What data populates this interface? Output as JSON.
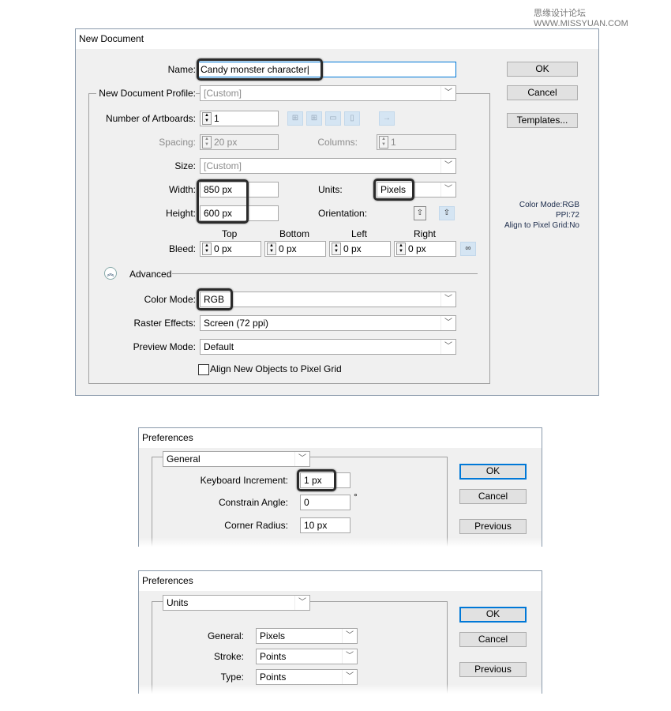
{
  "watermark": "思缘设计论坛 WWW.MISSYUAN.COM",
  "new_document": {
    "title": "New Document",
    "name_label": "Name:",
    "name_value": "Candy monster character",
    "profile_label": "New Document Profile:",
    "profile_value": "[Custom]",
    "artboards_label": "Number of Artboards:",
    "artboards_value": "1",
    "spacing_label": "Spacing:",
    "spacing_value": "20 px",
    "columns_label": "Columns:",
    "columns_value": "1",
    "size_label": "Size:",
    "size_value": "[Custom]",
    "width_label": "Width:",
    "width_value": "850 px",
    "height_label": "Height:",
    "height_value": "600 px",
    "units_label": "Units:",
    "units_value": "Pixels",
    "orientation_label": "Orientation:",
    "bleed_label": "Bleed:",
    "bleed": [
      {
        "label": "Top",
        "value": "0 px"
      },
      {
        "label": "Bottom",
        "value": "0 px"
      },
      {
        "label": "Left",
        "value": "0 px"
      },
      {
        "label": "Right",
        "value": "0 px"
      }
    ],
    "advanced_label": "Advanced",
    "color_mode_label": "Color Mode:",
    "color_mode_value": "RGB",
    "raster_label": "Raster Effects:",
    "raster_value": "Screen (72 ppi)",
    "preview_label": "Preview Mode:",
    "preview_value": "Default",
    "align_checkbox_label": "Align New Objects to Pixel Grid",
    "align_checked": false,
    "ok": "OK",
    "cancel": "Cancel",
    "templates": "Templates...",
    "info": [
      "Color Mode:RGB",
      "PPI:72",
      "Align to Pixel Grid:No"
    ]
  },
  "prefs_general": {
    "title": "Preferences",
    "section": "General",
    "rows": [
      {
        "label": "Keyboard Increment:",
        "value": "1 px"
      },
      {
        "label": "Constrain Angle:",
        "value": "0",
        "suffix": "°"
      },
      {
        "label": "Corner Radius:",
        "value": "10 px"
      }
    ],
    "ok": "OK",
    "cancel": "Cancel",
    "previous": "Previous"
  },
  "prefs_units": {
    "title": "Preferences",
    "section": "Units",
    "rows": [
      {
        "label": "General:",
        "value": "Pixels"
      },
      {
        "label": "Stroke:",
        "value": "Points"
      },
      {
        "label": "Type:",
        "value": "Points"
      }
    ],
    "ok": "OK",
    "cancel": "Cancel",
    "previous": "Previous"
  },
  "colors": {
    "highlight": "#2b2b2b",
    "focus": "#0078d7",
    "dialog_bg": "#f0f0f0"
  }
}
